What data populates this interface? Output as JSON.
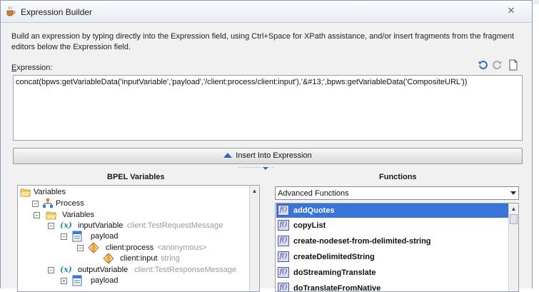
{
  "window": {
    "title": "Expression Builder",
    "close_glyph": "✕"
  },
  "description": "Build an expression by typing directly into the Expression field, using Ctrl+Space for XPath assistance, and/or insert fragments from the fragment editors below the Expression field.",
  "expression": {
    "label_underlined": "E",
    "label_rest": "xpression:",
    "value": "concat(bpws:getVariableData('inputVariable','payload','/client:process/client:input'),'&#13;',bpws:getVariableData('CompositeURL'))",
    "toolbar_icons": [
      "undo-icon",
      "redo-icon",
      "blank-page-icon"
    ]
  },
  "insert_button": {
    "label": "Insert Into Expression"
  },
  "bpel_variables": {
    "heading": "BPEL Variables",
    "tree": [
      {
        "label": "Variables",
        "hint": "",
        "icon": "folder-icon"
      },
      {
        "label": "Process",
        "hint": "",
        "icon": "process-icon"
      },
      {
        "label": "Variables",
        "hint": "",
        "icon": "folder-icon"
      },
      {
        "label": "inputVariable",
        "hint": "client:TestRequestMessage",
        "icon": "variable-icon"
      },
      {
        "label": "payload",
        "hint": "",
        "icon": "part-icon"
      },
      {
        "label": "client:process",
        "hint": "<anonymous>",
        "icon": "element-icon"
      },
      {
        "label": "client:input",
        "hint": "string",
        "icon": "element-icon"
      },
      {
        "label": "outputVariable",
        "hint": "client:TestResponseMessage",
        "icon": "variable-icon"
      },
      {
        "label": "payload",
        "hint": "",
        "icon": "part-icon"
      }
    ]
  },
  "functions": {
    "heading": "Functions",
    "category": "Advanced Functions",
    "icon_label": "f()",
    "items": [
      "addQuotes",
      "copyList",
      "create-nodeset-from-delimited-string",
      "createDelimitedString",
      "doStreamingTranslate",
      "doTranslateFromNative"
    ]
  },
  "colors": {
    "selection": "#3875d7",
    "accent": "#2d6ab6"
  }
}
